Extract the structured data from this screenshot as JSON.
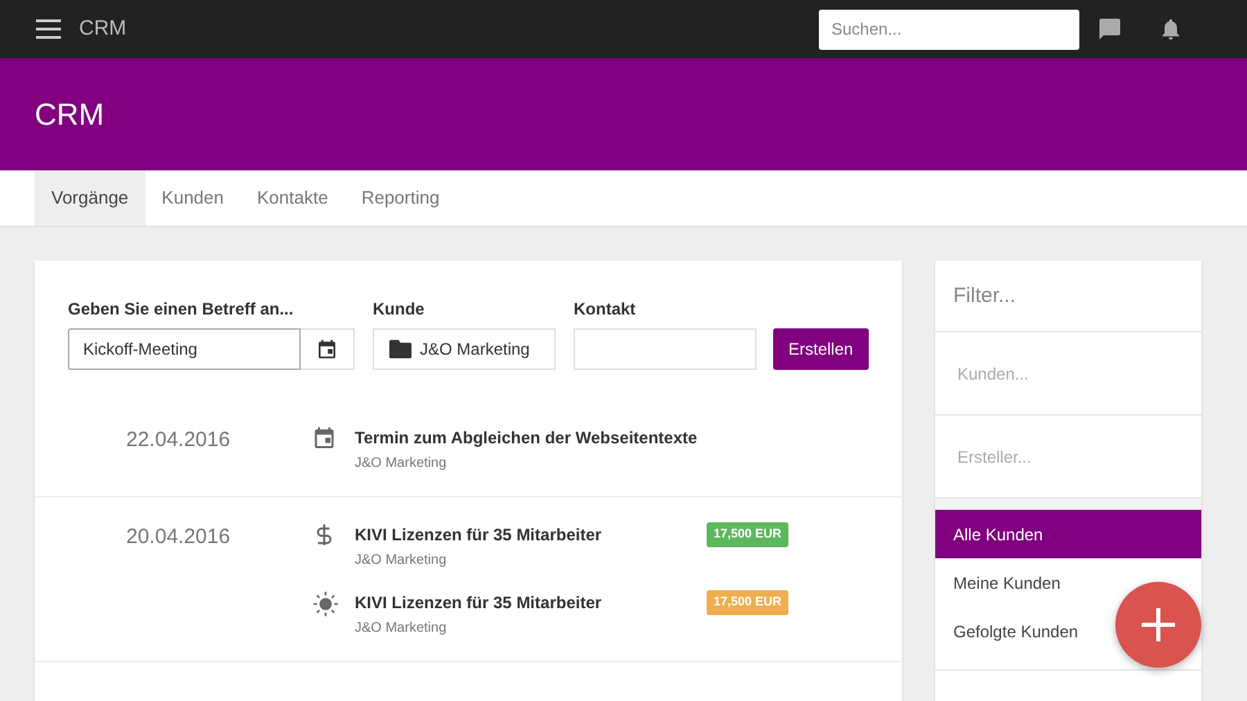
{
  "topbar": {
    "title": "CRM",
    "search": {
      "placeholder": "Suchen..."
    }
  },
  "header": {
    "title": "CRM"
  },
  "tabs": [
    {
      "label": "Vorgänge",
      "selected": true
    },
    {
      "label": "Kunden",
      "selected": false
    },
    {
      "label": "Kontakte",
      "selected": false
    },
    {
      "label": "Reporting",
      "selected": false
    }
  ],
  "form": {
    "subject": {
      "label": "Geben Sie einen Betreff an...",
      "value": "Kickoff-Meeting"
    },
    "customer": {
      "label": "Kunde",
      "value": "J&O Marketing"
    },
    "contact": {
      "label": "Kontakt"
    },
    "submit": "Erstellen"
  },
  "groups": [
    {
      "date": "22.04.2016",
      "items": [
        {
          "kind": "appointment",
          "title": "Termin zum Abgleichen der Webseitentexte",
          "customer": "J&O Marketing"
        }
      ]
    },
    {
      "date": "20.04.2016",
      "items": [
        {
          "kind": "deal",
          "title": "KIVI Lizenzen für 35 Mitarbeiter",
          "customer": "J&O Marketing",
          "amount": "17,500 EUR",
          "color": "#5cb85c"
        },
        {
          "kind": "lead",
          "title": "KIVI Lizenzen für 35 Mitarbeiter",
          "customer": "J&O Marketing",
          "amount": "17,500 EUR",
          "color": "#f0ad4e"
        }
      ]
    }
  ],
  "sidebar": {
    "filter": {
      "placeholder": "Filter..."
    },
    "fields": [
      {
        "placeholder": "Kunden..."
      },
      {
        "placeholder": "Ersteller..."
      }
    ],
    "items": [
      {
        "label": "Alle Kunden",
        "selected": true
      },
      {
        "label": "Meine Kunden",
        "selected": false
      },
      {
        "label": "Gefolgte Kunden",
        "selected": false
      }
    ]
  }
}
